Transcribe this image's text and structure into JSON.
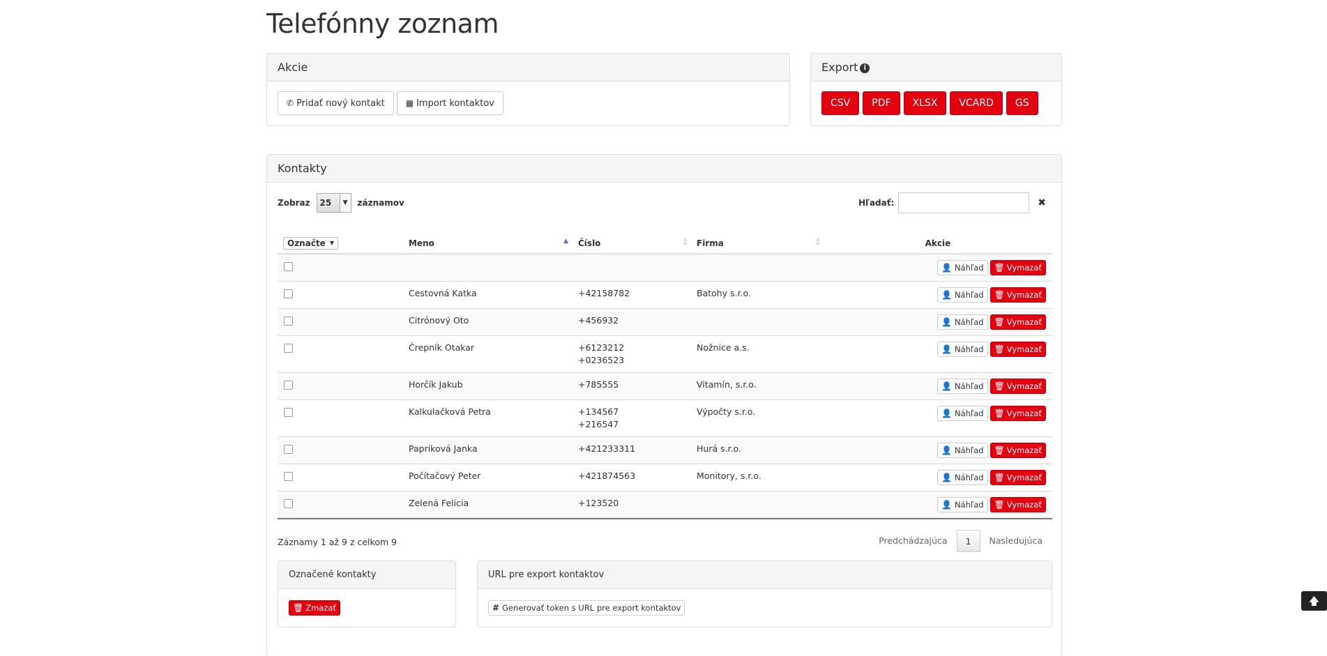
{
  "page": {
    "title": "Telefónny zoznam"
  },
  "actions_panel": {
    "title": "Akcie",
    "add_contact": "Pridať nový kontakt",
    "import_contacts": "Import kontaktov"
  },
  "export_panel": {
    "title": "Export",
    "buttons": [
      "CSV",
      "PDF",
      "XLSX",
      "VCARD",
      "GS"
    ]
  },
  "contacts_panel": {
    "title": "Kontakty",
    "show_label": "Zobraz",
    "page_size": "25",
    "records_label": "záznamov",
    "search_label": "Hľadať:",
    "search_value": "",
    "clear_symbol": "✖",
    "columns": {
      "select": "Označte",
      "name": "Meno",
      "number": "Číslo",
      "company": "Firma",
      "actions": "Akcie"
    },
    "view_label": "Náhľad",
    "delete_label": "Vymazať",
    "rows": [
      {
        "name": "",
        "numbers": [
          ""
        ],
        "company": ""
      },
      {
        "name": "Cestovná Katka",
        "numbers": [
          "+42158782"
        ],
        "company": "Batohy s.r.o."
      },
      {
        "name": "Citrónový Oto",
        "numbers": [
          "+456932"
        ],
        "company": ""
      },
      {
        "name": "Črepník Otakar",
        "numbers": [
          "+6123212",
          "+0236523"
        ],
        "company": "Nožnice a.s."
      },
      {
        "name": "Horčík Jakub",
        "numbers": [
          "+785555"
        ],
        "company": "Vitamín, s.r.o."
      },
      {
        "name": "Kalkulačková Petra",
        "numbers": [
          "+134567",
          "+216547"
        ],
        "company": "Výpočty s.r.o."
      },
      {
        "name": "Papriková Janka",
        "numbers": [
          "+421233311"
        ],
        "company": "Hurá s.r.o."
      },
      {
        "name": "Počítačový Peter",
        "numbers": [
          "+421874563"
        ],
        "company": "Monitory, s.r.o."
      },
      {
        "name": "Zelená Felicia",
        "numbers": [
          "+123520"
        ],
        "company": ""
      }
    ],
    "info": "Záznamy 1 až 9 z celkom 9",
    "pager": {
      "previous": "Predchádzajúca",
      "current": "1",
      "next": "Nasledujúca"
    }
  },
  "marked_panel": {
    "title": "Označené kontakty",
    "delete_button": "Zmazať"
  },
  "url_panel": {
    "title": "URL pre export kontaktov",
    "token_button": "Generovať token s URL pre export kontaktov"
  },
  "colors": {
    "accent_red": "#e3000f",
    "panel_heading_bg": "#f5f5f5"
  },
  "icons": {
    "add_contact": "phone-icon",
    "import": "table-icon",
    "info": "info-icon",
    "view": "user-plus-icon",
    "delete": "trash-icon",
    "token": "hash-icon",
    "scroll_top": "arrow-up-icon"
  }
}
